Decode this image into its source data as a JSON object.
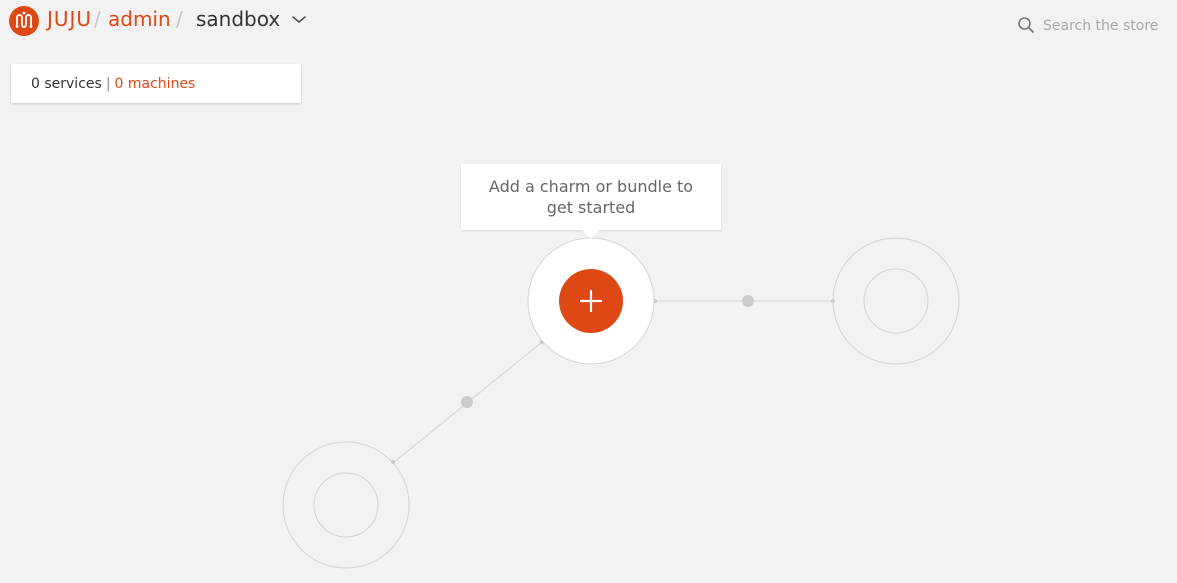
{
  "header": {
    "logo_text": "JUJU",
    "breadcrumb": {
      "separator": "/",
      "user": "admin",
      "model": "sandbox"
    }
  },
  "search": {
    "placeholder": "Search the store"
  },
  "counts": {
    "services": "0 services",
    "separator": "|",
    "machines": "0 machines"
  },
  "canvas": {
    "tooltip_text": "Add a charm or bundle to get started",
    "add_button_icon": "plus-icon"
  },
  "colors": {
    "accent": "#dd4814",
    "background": "#f2f2f2",
    "panel": "#ffffff",
    "placeholder_ring": "#d4d4d4"
  }
}
